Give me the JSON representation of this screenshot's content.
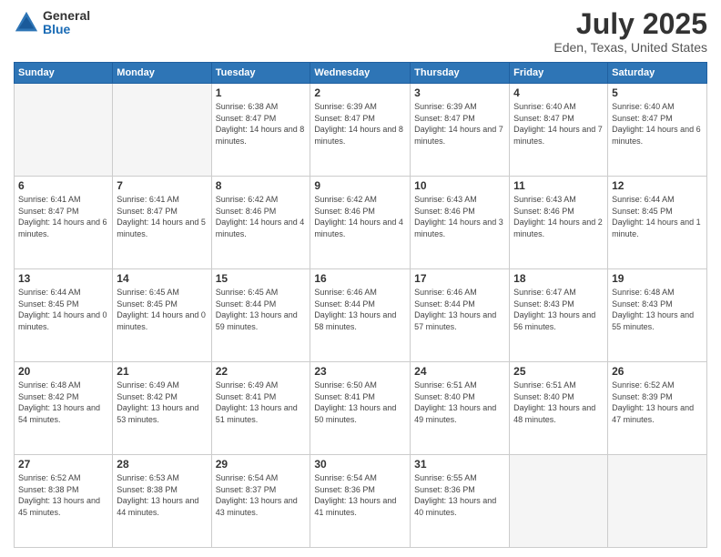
{
  "logo": {
    "general": "General",
    "blue": "Blue"
  },
  "header": {
    "month": "July 2025",
    "location": "Eden, Texas, United States"
  },
  "weekdays": [
    "Sunday",
    "Monday",
    "Tuesday",
    "Wednesday",
    "Thursday",
    "Friday",
    "Saturday"
  ],
  "weeks": [
    [
      {
        "day": "",
        "sunrise": "",
        "sunset": "",
        "daylight": ""
      },
      {
        "day": "",
        "sunrise": "",
        "sunset": "",
        "daylight": ""
      },
      {
        "day": "1",
        "sunrise": "Sunrise: 6:38 AM",
        "sunset": "Sunset: 8:47 PM",
        "daylight": "Daylight: 14 hours and 8 minutes."
      },
      {
        "day": "2",
        "sunrise": "Sunrise: 6:39 AM",
        "sunset": "Sunset: 8:47 PM",
        "daylight": "Daylight: 14 hours and 8 minutes."
      },
      {
        "day": "3",
        "sunrise": "Sunrise: 6:39 AM",
        "sunset": "Sunset: 8:47 PM",
        "daylight": "Daylight: 14 hours and 7 minutes."
      },
      {
        "day": "4",
        "sunrise": "Sunrise: 6:40 AM",
        "sunset": "Sunset: 8:47 PM",
        "daylight": "Daylight: 14 hours and 7 minutes."
      },
      {
        "day": "5",
        "sunrise": "Sunrise: 6:40 AM",
        "sunset": "Sunset: 8:47 PM",
        "daylight": "Daylight: 14 hours and 6 minutes."
      }
    ],
    [
      {
        "day": "6",
        "sunrise": "Sunrise: 6:41 AM",
        "sunset": "Sunset: 8:47 PM",
        "daylight": "Daylight: 14 hours and 6 minutes."
      },
      {
        "day": "7",
        "sunrise": "Sunrise: 6:41 AM",
        "sunset": "Sunset: 8:47 PM",
        "daylight": "Daylight: 14 hours and 5 minutes."
      },
      {
        "day": "8",
        "sunrise": "Sunrise: 6:42 AM",
        "sunset": "Sunset: 8:46 PM",
        "daylight": "Daylight: 14 hours and 4 minutes."
      },
      {
        "day": "9",
        "sunrise": "Sunrise: 6:42 AM",
        "sunset": "Sunset: 8:46 PM",
        "daylight": "Daylight: 14 hours and 4 minutes."
      },
      {
        "day": "10",
        "sunrise": "Sunrise: 6:43 AM",
        "sunset": "Sunset: 8:46 PM",
        "daylight": "Daylight: 14 hours and 3 minutes."
      },
      {
        "day": "11",
        "sunrise": "Sunrise: 6:43 AM",
        "sunset": "Sunset: 8:46 PM",
        "daylight": "Daylight: 14 hours and 2 minutes."
      },
      {
        "day": "12",
        "sunrise": "Sunrise: 6:44 AM",
        "sunset": "Sunset: 8:45 PM",
        "daylight": "Daylight: 14 hours and 1 minute."
      }
    ],
    [
      {
        "day": "13",
        "sunrise": "Sunrise: 6:44 AM",
        "sunset": "Sunset: 8:45 PM",
        "daylight": "Daylight: 14 hours and 0 minutes."
      },
      {
        "day": "14",
        "sunrise": "Sunrise: 6:45 AM",
        "sunset": "Sunset: 8:45 PM",
        "daylight": "Daylight: 14 hours and 0 minutes."
      },
      {
        "day": "15",
        "sunrise": "Sunrise: 6:45 AM",
        "sunset": "Sunset: 8:44 PM",
        "daylight": "Daylight: 13 hours and 59 minutes."
      },
      {
        "day": "16",
        "sunrise": "Sunrise: 6:46 AM",
        "sunset": "Sunset: 8:44 PM",
        "daylight": "Daylight: 13 hours and 58 minutes."
      },
      {
        "day": "17",
        "sunrise": "Sunrise: 6:46 AM",
        "sunset": "Sunset: 8:44 PM",
        "daylight": "Daylight: 13 hours and 57 minutes."
      },
      {
        "day": "18",
        "sunrise": "Sunrise: 6:47 AM",
        "sunset": "Sunset: 8:43 PM",
        "daylight": "Daylight: 13 hours and 56 minutes."
      },
      {
        "day": "19",
        "sunrise": "Sunrise: 6:48 AM",
        "sunset": "Sunset: 8:43 PM",
        "daylight": "Daylight: 13 hours and 55 minutes."
      }
    ],
    [
      {
        "day": "20",
        "sunrise": "Sunrise: 6:48 AM",
        "sunset": "Sunset: 8:42 PM",
        "daylight": "Daylight: 13 hours and 54 minutes."
      },
      {
        "day": "21",
        "sunrise": "Sunrise: 6:49 AM",
        "sunset": "Sunset: 8:42 PM",
        "daylight": "Daylight: 13 hours and 53 minutes."
      },
      {
        "day": "22",
        "sunrise": "Sunrise: 6:49 AM",
        "sunset": "Sunset: 8:41 PM",
        "daylight": "Daylight: 13 hours and 51 minutes."
      },
      {
        "day": "23",
        "sunrise": "Sunrise: 6:50 AM",
        "sunset": "Sunset: 8:41 PM",
        "daylight": "Daylight: 13 hours and 50 minutes."
      },
      {
        "day": "24",
        "sunrise": "Sunrise: 6:51 AM",
        "sunset": "Sunset: 8:40 PM",
        "daylight": "Daylight: 13 hours and 49 minutes."
      },
      {
        "day": "25",
        "sunrise": "Sunrise: 6:51 AM",
        "sunset": "Sunset: 8:40 PM",
        "daylight": "Daylight: 13 hours and 48 minutes."
      },
      {
        "day": "26",
        "sunrise": "Sunrise: 6:52 AM",
        "sunset": "Sunset: 8:39 PM",
        "daylight": "Daylight: 13 hours and 47 minutes."
      }
    ],
    [
      {
        "day": "27",
        "sunrise": "Sunrise: 6:52 AM",
        "sunset": "Sunset: 8:38 PM",
        "daylight": "Daylight: 13 hours and 45 minutes."
      },
      {
        "day": "28",
        "sunrise": "Sunrise: 6:53 AM",
        "sunset": "Sunset: 8:38 PM",
        "daylight": "Daylight: 13 hours and 44 minutes."
      },
      {
        "day": "29",
        "sunrise": "Sunrise: 6:54 AM",
        "sunset": "Sunset: 8:37 PM",
        "daylight": "Daylight: 13 hours and 43 minutes."
      },
      {
        "day": "30",
        "sunrise": "Sunrise: 6:54 AM",
        "sunset": "Sunset: 8:36 PM",
        "daylight": "Daylight: 13 hours and 41 minutes."
      },
      {
        "day": "31",
        "sunrise": "Sunrise: 6:55 AM",
        "sunset": "Sunset: 8:36 PM",
        "daylight": "Daylight: 13 hours and 40 minutes."
      },
      {
        "day": "",
        "sunrise": "",
        "sunset": "",
        "daylight": ""
      },
      {
        "day": "",
        "sunrise": "",
        "sunset": "",
        "daylight": ""
      }
    ]
  ]
}
